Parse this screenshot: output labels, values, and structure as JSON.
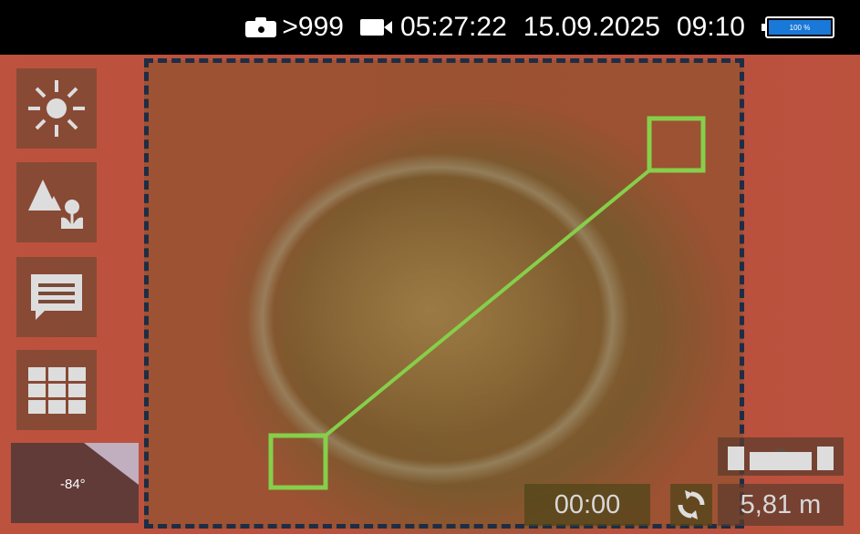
{
  "statusbar": {
    "photo_count": ">999",
    "video_time": "05:27:22",
    "date": "15.09.2025",
    "time": "09:10",
    "battery_label": "100 %",
    "battery_level_percent": 100,
    "icons": [
      "camera-icon",
      "video-camera-icon",
      "battery-icon"
    ]
  },
  "toolbar": {
    "buttons": [
      {
        "name": "brightness-button",
        "icon": "sun-icon"
      },
      {
        "name": "scene-mode-button",
        "icon": "landscape-flower-icon"
      },
      {
        "name": "annotation-button",
        "icon": "comment-icon"
      },
      {
        "name": "grid-button",
        "icon": "grid-icon"
      }
    ],
    "angle_value": "-84°"
  },
  "measurement": {
    "timer": "00:00",
    "distance": "5,81 m",
    "line_color": "#86cf4a",
    "frame_color": "#1e2d45"
  },
  "colors": {
    "accent_green": "#86cf4a",
    "battery_blue": "#1978d8"
  }
}
